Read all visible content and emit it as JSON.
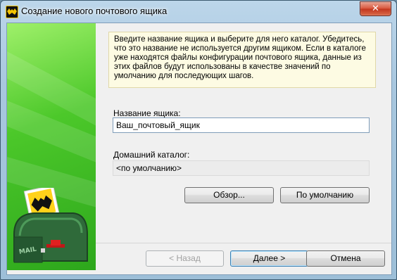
{
  "window": {
    "title": "Создание нового почтового ящика",
    "close_glyph": "✕"
  },
  "colors": {
    "side_panel": "#3bb824",
    "info_bg": "#fdfbe3",
    "accent": "#3c7fb1"
  },
  "info_text": "Введите название ящика и выберите для него каталог. Убедитесь, что это название не используется другим ящиком. Если в каталоге уже находятся файлы конфигурации почтового ящика, данные из этих файлов будут использованы в качестве значений по умолчанию для последующих шагов.",
  "mailbox_name": {
    "label": "Название ящика:",
    "value": "Ваш_почтовый_ящик"
  },
  "home_dir": {
    "label": "Домашний каталог:",
    "value": "<по умолчанию>"
  },
  "buttons": {
    "browse": "Обзор...",
    "default": "По умолчанию",
    "back": "< Назад",
    "next": "Далее >",
    "cancel": "Отмена"
  },
  "side_image": {
    "mailbox_text": "MAIL",
    "icon": "mailbox-with-bat-stamp"
  }
}
